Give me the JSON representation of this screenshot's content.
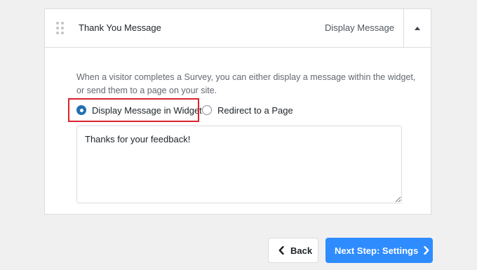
{
  "panel": {
    "title": "Thank You Message",
    "subtitle": "Display Message"
  },
  "description": {
    "line1": "When a visitor completes a Survey, you can either display a message within the widget,",
    "line2": "or send them to a page on your site."
  },
  "options": [
    {
      "label": "Display Message in Widget",
      "selected": true
    },
    {
      "label": "Redirect to a Page",
      "selected": false
    }
  ],
  "message": {
    "value": "Thanks for your feedback!"
  },
  "footer": {
    "back_label": "Back",
    "next_label": "Next Step: Settings"
  },
  "colors": {
    "accent": "#2271b1",
    "primary_button": "#2e8cff",
    "highlight": "#d9232e",
    "background": "#f0f0f1"
  }
}
